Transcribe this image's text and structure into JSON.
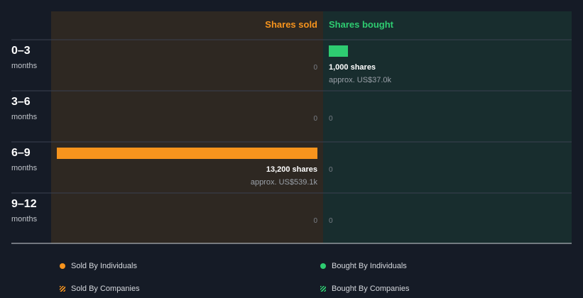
{
  "chart_data": {
    "type": "bar",
    "columns": {
      "sold": "Shares sold",
      "bought": "Shares bought"
    },
    "periods": [
      {
        "value": "0–3",
        "unit": "months"
      },
      {
        "value": "3–6",
        "unit": "months"
      },
      {
        "value": "6–9",
        "unit": "months"
      },
      {
        "value": "9–12",
        "unit": "months"
      }
    ],
    "sold": [
      {
        "shares": 0,
        "label": "0"
      },
      {
        "shares": 0,
        "label": "0"
      },
      {
        "shares": 13200,
        "label": "13,200 shares",
        "approx": "approx. US$539.1k"
      },
      {
        "shares": 0,
        "label": "0"
      }
    ],
    "bought": [
      {
        "shares": 1000,
        "label": "1,000 shares",
        "approx": "approx. US$37.0k"
      },
      {
        "shares": 0,
        "label": "0"
      },
      {
        "shares": 0,
        "label": "0"
      },
      {
        "shares": 0,
        "label": "0"
      }
    ],
    "max_shares": 13200,
    "colors": {
      "sold": "#f7941d",
      "bought": "#2ecc71",
      "sold_bg": "#2e2822",
      "bought_bg": "#182d2e",
      "zero_text": "#7a7f87",
      "approx_text": "#9aa0a8"
    },
    "legend": [
      {
        "label": "Sold By Individuals",
        "marker": "dot",
        "color": "#f7941d"
      },
      {
        "label": "Bought By Individuals",
        "marker": "dot",
        "color": "#2ecc71"
      },
      {
        "label": "Sold By Companies",
        "marker": "hatch",
        "color": "#f7941d"
      },
      {
        "label": "Bought By Companies",
        "marker": "hatch",
        "color": "#2ecc71"
      }
    ]
  }
}
